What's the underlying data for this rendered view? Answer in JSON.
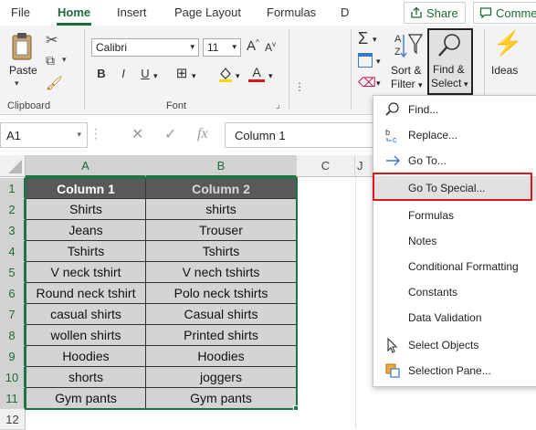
{
  "tabs": [
    "File",
    "Home",
    "Insert",
    "Page Layout",
    "Formulas",
    "D"
  ],
  "share_label": "Share",
  "comments_label": "Comme",
  "ribbon": {
    "paste_label": "Paste",
    "clipboard_label": "Clipboard",
    "font_name": "Calibri",
    "font_size": "11",
    "font_label": "Font",
    "sort_filter_label1": "Sort &",
    "sort_filter_label2": "Filter",
    "find_select_label1": "Find &",
    "find_select_label2": "Select",
    "ideas_label": "Ideas"
  },
  "formula_bar": {
    "name_box": "A1",
    "content": "Column 1"
  },
  "columns": [
    "A",
    "B",
    "C",
    "J"
  ],
  "rows": [
    "1",
    "2",
    "3",
    "4",
    "5",
    "6",
    "7",
    "8",
    "9",
    "10",
    "11",
    "12"
  ],
  "table": {
    "headers": [
      "Column 1",
      "Column 2"
    ],
    "data": [
      [
        "Shirts",
        "shirts"
      ],
      [
        "Jeans",
        "Trouser"
      ],
      [
        "Tshirts",
        "Tshirts"
      ],
      [
        "V neck tshirt",
        "V nech tshirts"
      ],
      [
        "Round neck tshirt",
        "Polo neck tshirts"
      ],
      [
        "casual shirts",
        "Casual shirts"
      ],
      [
        "wollen shirts",
        "Printed shirts"
      ],
      [
        "Hoodies",
        "Hoodies"
      ],
      [
        "shorts",
        "joggers"
      ],
      [
        "Gym pants",
        "Gym pants"
      ]
    ]
  },
  "menu": {
    "items": [
      {
        "label": "Find...",
        "icon": "search-icon"
      },
      {
        "label": "Replace...",
        "icon": "replace-icon"
      },
      {
        "label": "Go To...",
        "icon": "arrow-right-icon"
      },
      {
        "label": "Go To Special...",
        "icon": ""
      },
      {
        "label": "Formulas",
        "icon": ""
      },
      {
        "label": "Notes",
        "icon": ""
      },
      {
        "label": "Conditional Formatting",
        "icon": ""
      },
      {
        "label": "Constants",
        "icon": ""
      },
      {
        "label": "Data Validation",
        "icon": ""
      },
      {
        "label": "Select Objects",
        "icon": "cursor-icon"
      },
      {
        "label": "Selection Pane...",
        "icon": "selection-pane-icon"
      }
    ]
  },
  "colors": {
    "accent": "#1e6b3c",
    "header_fill": "#595959",
    "cell_fill": "#d4d4d4",
    "highlight": "#e0161b"
  }
}
